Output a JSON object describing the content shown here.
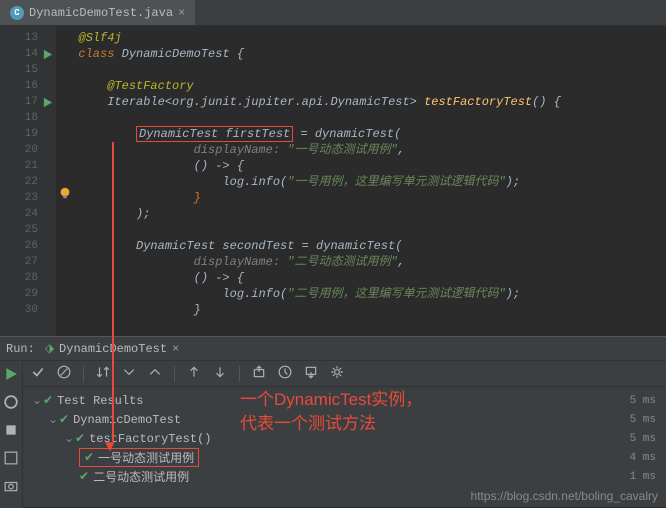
{
  "tab": {
    "filename": "DynamicDemoTest.java",
    "icon_letter": "C"
  },
  "lines": {
    "13": "13",
    "14": "14",
    "15": "15",
    "16": "16",
    "17": "17",
    "18": "18",
    "19": "19",
    "20": "20",
    "21": "21",
    "22": "22",
    "23": "23",
    "24": "24",
    "25": "25",
    "26": "26",
    "27": "27",
    "28": "28",
    "29": "29",
    "30": "30"
  },
  "code": {
    "l13": "@Slf4j",
    "l14_kw": "class ",
    "l14_name": "DynamicDemoTest {",
    "l16": "@TestFactory",
    "l17_pre": "Iterable<org.junit.jupiter.api.DynamicTest> ",
    "l17_method": "testFactoryTest",
    "l17_post": "() {",
    "l19_box": "DynamicTest firstTest",
    "l19_post": " = dynamicTest(",
    "l20_param": "displayName: ",
    "l20_str": "\"一号动态测试用例\"",
    "l20_post": ",",
    "l21": "() -> {",
    "l22_pre": "log",
    "l22_dot": ".info(",
    "l22_str": "\"一号用例，这里编写单元测试逻辑代码\"",
    "l22_post": ");",
    "l23": "}",
    "l24": ");",
    "l26_pre": "DynamicTest secondTest = ",
    "l26_call": "dynamicTest",
    "l26_post": "(",
    "l27_param": "displayName: ",
    "l27_str": "\"二号动态测试用例\"",
    "l27_post": ",",
    "l28": "() -> {",
    "l29_pre": "log",
    "l29_dot": ".info(",
    "l29_str": "\"二号用例，这里编写单元测试逻辑代码\"",
    "l29_post": ");",
    "l30": "}"
  },
  "run": {
    "label": "Run:",
    "tab_name": "DynamicDemoTest",
    "results": {
      "root": "Test Results",
      "root_time": "5 ms",
      "class": "DynamicDemoTest",
      "class_time": "5 ms",
      "method": "testFactoryTest()",
      "method_time": "5 ms",
      "test1": "一号动态测试用例",
      "test1_time": "4 ms",
      "test2": "二号动态测试用例",
      "test2_time": "1 ms"
    }
  },
  "annotation": {
    "line1": "一个DynamicTest实例，",
    "line2": "代表一个测试方法"
  },
  "watermark": "https://blog.csdn.net/boling_cavalry"
}
